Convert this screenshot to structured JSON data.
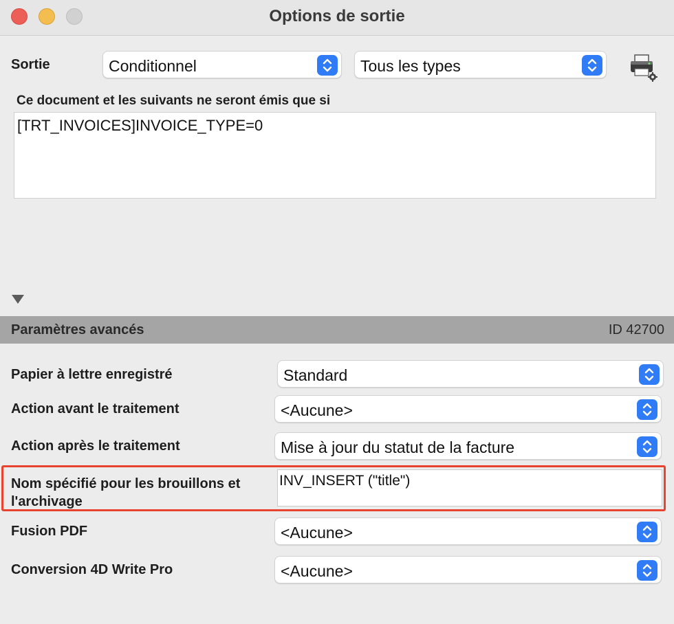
{
  "window": {
    "title": "Options de sortie"
  },
  "output": {
    "label": "Sortie",
    "mode": "Conditionnel",
    "types": "Tous les types"
  },
  "condition": {
    "label": "Ce document et les suivants ne seront émis que si",
    "formula": "[TRT_INVOICES]INVOICE_TYPE=0"
  },
  "advanced": {
    "title": "Paramètres avancés",
    "id": "ID 42700",
    "letterhead": {
      "label": "Papier à lettre enregistré",
      "value": "Standard"
    },
    "action_before": {
      "label": "Action avant le traitement",
      "value": "<Aucune>"
    },
    "action_after": {
      "label": "Action après le traitement",
      "value": "Mise à jour du statut de la facture"
    },
    "draft_name": {
      "label_line1": "Nom spécifié pour les brouillons et",
      "label_line2": "l'archivage",
      "value": "INV_INSERT (\"title\")"
    },
    "pdf_merge": {
      "label": "Fusion PDF",
      "value": "<Aucune>"
    },
    "write_pro": {
      "label": "Conversion 4D Write Pro",
      "value": "<Aucune>"
    }
  },
  "icons": {
    "stepper": "up-down-chevron-icon",
    "printer": "printer-settings-icon",
    "disclosure": "disclosure-triangle-icon"
  },
  "colors": {
    "accent": "#2f7cf6",
    "highlight": "#e8432e",
    "section_bar": "#a5a5a5"
  }
}
